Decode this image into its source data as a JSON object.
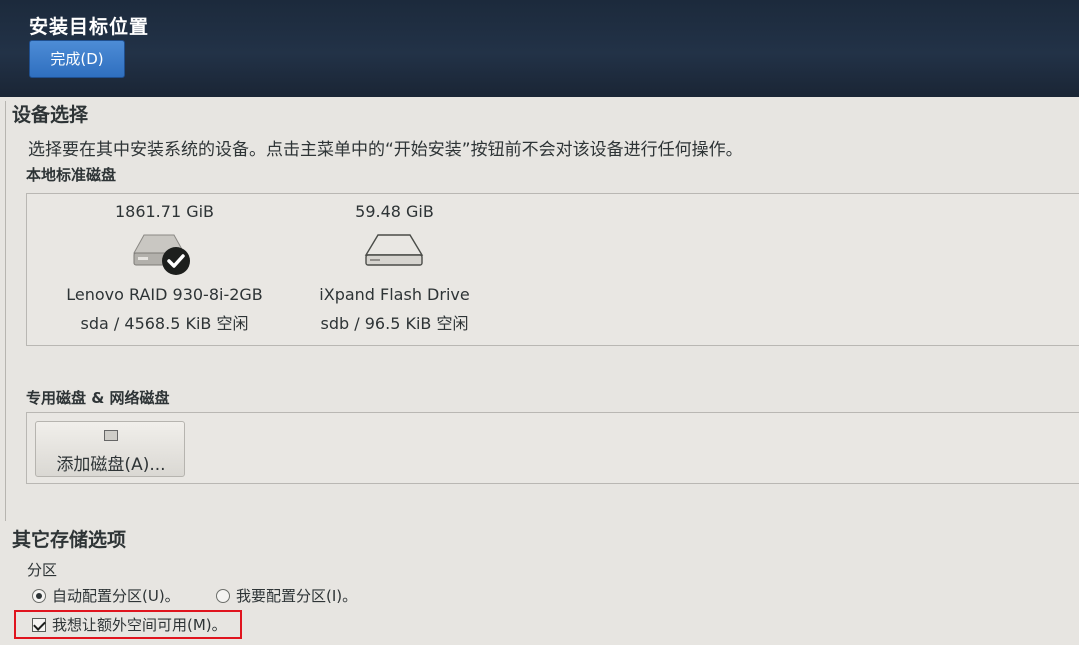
{
  "header": {
    "title": "安装目标位置",
    "done_label": "完成(D)"
  },
  "device_selection": {
    "title": "设备选择",
    "description": "选择要在其中安装系统的设备。点击主菜单中的“开始安装”按钮前不会对该设备进行任何操作。",
    "local_disks_label": "本地标准磁盘",
    "disks": [
      {
        "size": "1861.71 GiB",
        "name": "Lenovo RAID 930-8i-2GB",
        "meta": "sda  /  4568.5 KiB 空闲",
        "selected": true,
        "icon": "hard-disk-icon"
      },
      {
        "size": "59.48 GiB",
        "name": "iXpand Flash Drive",
        "meta": "sdb / 96.5 KiB 空闲",
        "selected": false,
        "icon": "flash-drive-icon"
      }
    ],
    "specialized_label": "专用磁盘 & 网络磁盘",
    "add_disk_label": "添加磁盘(A)..."
  },
  "other_options": {
    "title": "其它存储选项",
    "partition_label": "分区",
    "auto_partition_label": "自动配置分区(U)。",
    "manual_partition_label": "我要配置分区(I)。",
    "auto_selected": true,
    "extra_space_label": "我想让额外空间可用(M)。",
    "extra_space_checked": true
  },
  "colors": {
    "header_bg": "#1c2a3c",
    "accent_button": "#3a7acb",
    "highlight_border": "#e0141e"
  }
}
